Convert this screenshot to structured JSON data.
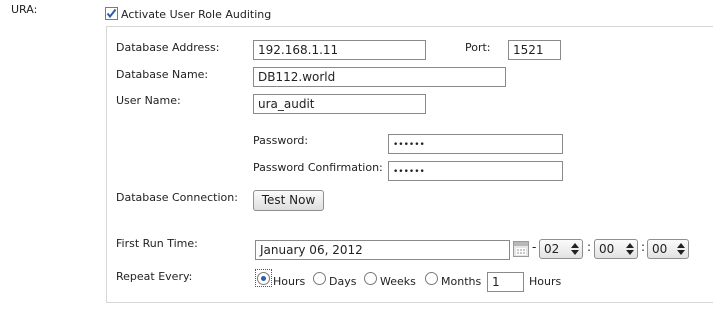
{
  "ura_label": "URA:",
  "activate": {
    "label": "Activate User Role Auditing",
    "checked": true
  },
  "fields": {
    "db_address_label": "Database Address:",
    "db_address_value": "192.168.1.11",
    "port_label": "Port:",
    "port_value": "1521",
    "db_name_label": "Database Name:",
    "db_name_value": "DB112.world",
    "user_name_label": "User Name:",
    "user_name_value": "ura_audit",
    "password_label": "Password:",
    "password_value": "••••••",
    "password_confirm_label": "Password Confirmation:",
    "password_confirm_value": "••••••",
    "db_connection_label": "Database Connection:",
    "test_now_label": "Test Now"
  },
  "schedule": {
    "first_run_label": "First Run Time:",
    "date_value": "January 06, 2012",
    "dash": "-",
    "colon": ":",
    "hour": "02",
    "minute": "00",
    "second": "00",
    "repeat_label": "Repeat Every:",
    "options": [
      "Hours",
      "Days",
      "Weeks",
      "Months"
    ],
    "selected_option": "Hours",
    "interval_value": "1",
    "interval_unit": "Hours"
  },
  "icons": {
    "checkbox": "checkmark-icon",
    "calendar": "calendar-icon",
    "spinner": "spin-arrows-icon"
  }
}
